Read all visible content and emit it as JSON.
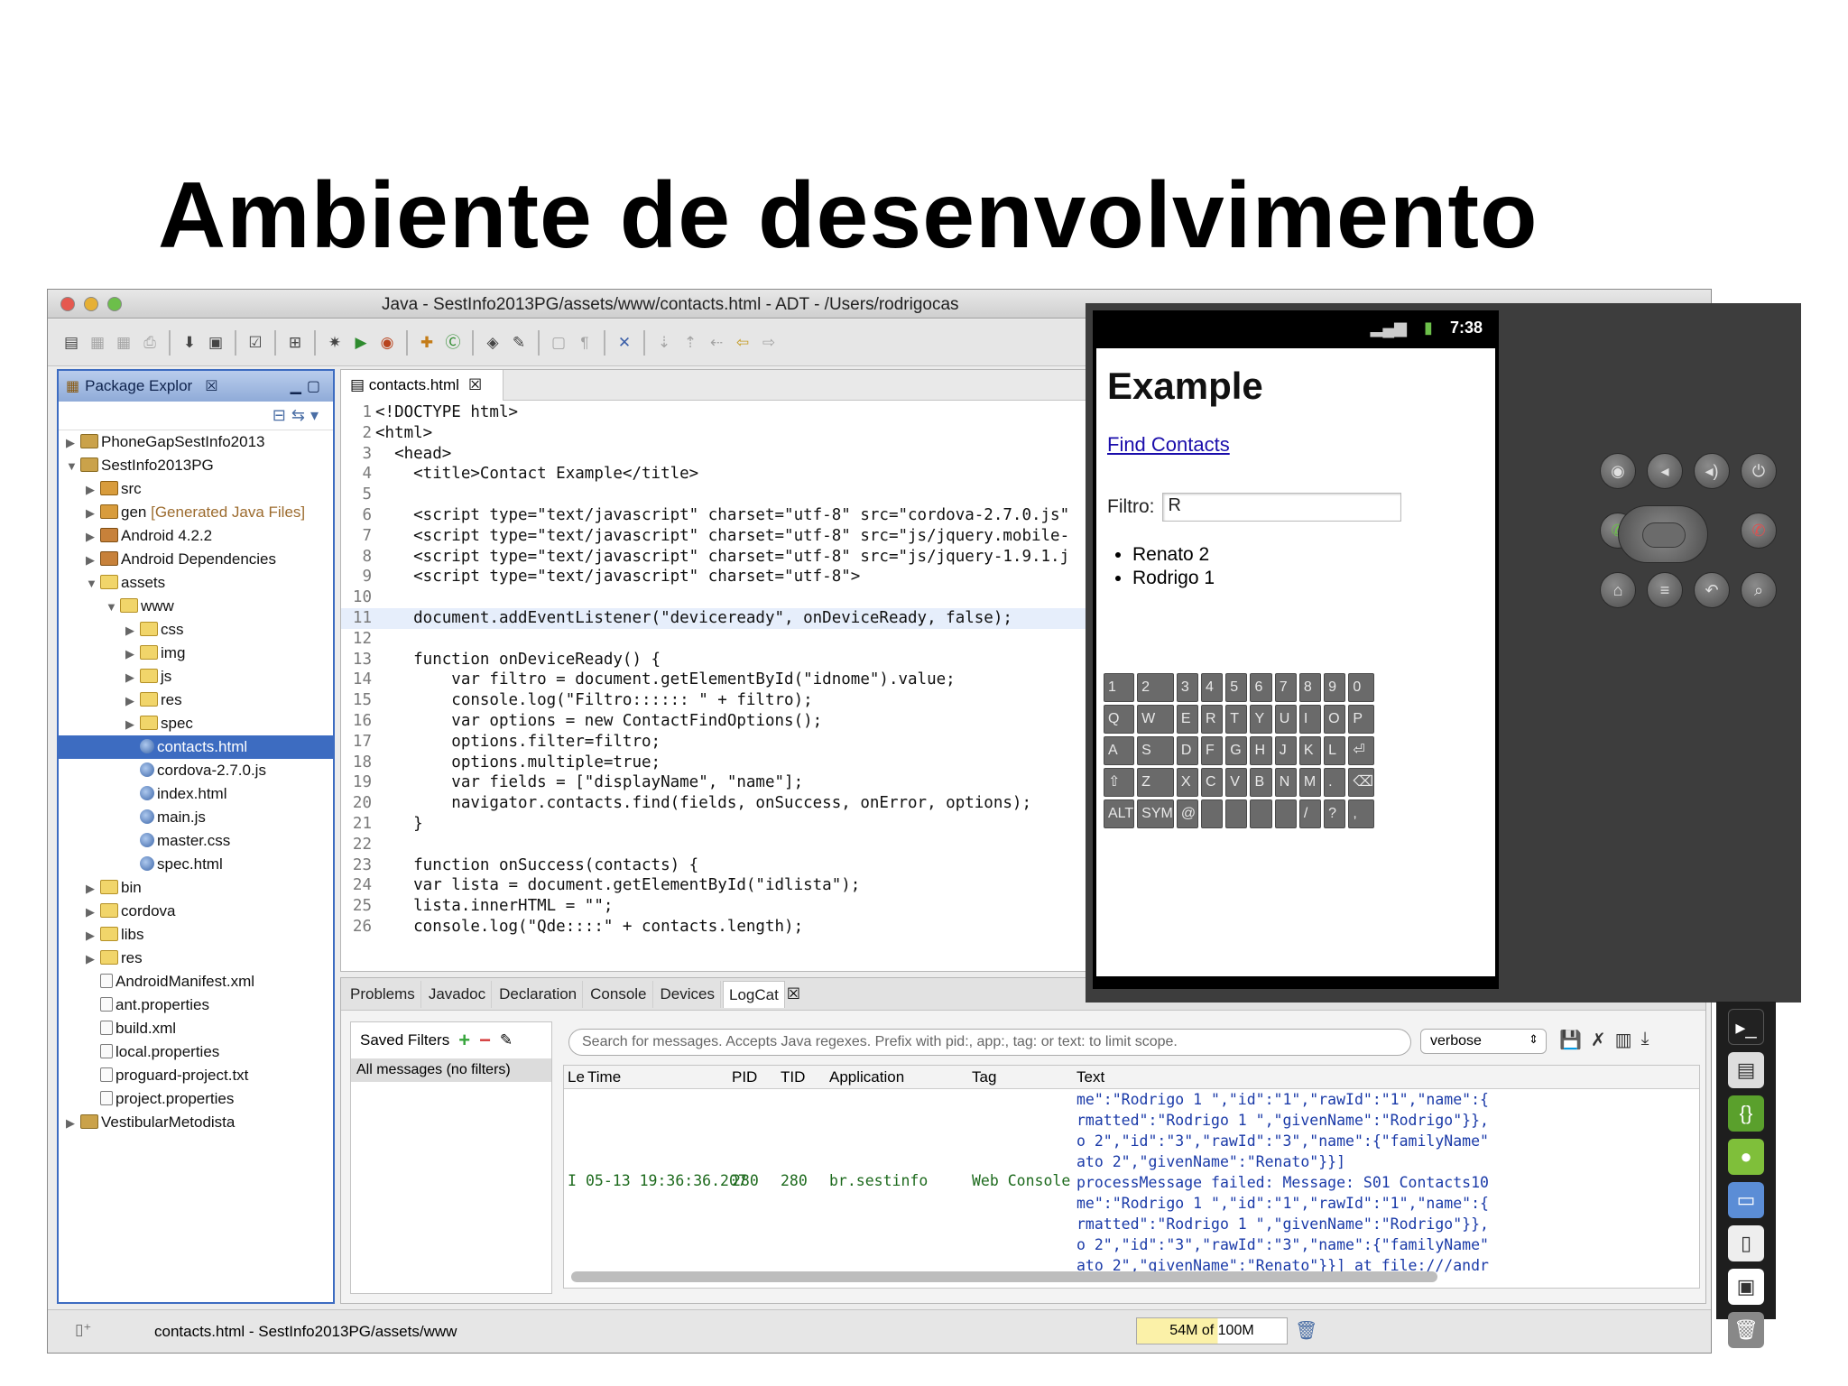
{
  "slide": {
    "title": "Ambiente de desenvolvimento"
  },
  "window": {
    "title": "Java - SestInfo2013PG/assets/www/contacts.html - ADT - /Users/rodrigocas"
  },
  "package_explorer": {
    "tab_label": "Package Explor",
    "items": [
      {
        "label": "PhoneGapSestInfo2013",
        "depth": 0,
        "arrow": "▶",
        "icon": "project-icon"
      },
      {
        "label": "SestInfo2013PG",
        "depth": 0,
        "arrow": "▼",
        "icon": "project-icon"
      },
      {
        "label": "src",
        "depth": 1,
        "arrow": "▶",
        "icon": "package-folder-icon"
      },
      {
        "label": "gen",
        "hint": "[Generated Java Files]",
        "depth": 1,
        "arrow": "▶",
        "icon": "package-folder-icon"
      },
      {
        "label": "Android 4.2.2",
        "depth": 1,
        "arrow": "▶",
        "icon": "library-icon"
      },
      {
        "label": "Android Dependencies",
        "depth": 1,
        "arrow": "▶",
        "icon": "library-icon"
      },
      {
        "label": "assets",
        "depth": 1,
        "arrow": "▼",
        "icon": "folder-icon"
      },
      {
        "label": "www",
        "depth": 2,
        "arrow": "▼",
        "icon": "folder-icon"
      },
      {
        "label": "css",
        "depth": 3,
        "arrow": "▶",
        "icon": "folder-icon"
      },
      {
        "label": "img",
        "depth": 3,
        "arrow": "▶",
        "icon": "folder-icon"
      },
      {
        "label": "js",
        "depth": 3,
        "arrow": "▶",
        "icon": "folder-icon"
      },
      {
        "label": "res",
        "depth": 3,
        "arrow": "▶",
        "icon": "folder-icon"
      },
      {
        "label": "spec",
        "depth": 3,
        "arrow": "▶",
        "icon": "folder-icon"
      },
      {
        "label": "contacts.html",
        "depth": 3,
        "arrow": "",
        "icon": "web-file-icon",
        "selected": true
      },
      {
        "label": "cordova-2.7.0.js",
        "depth": 3,
        "arrow": "",
        "icon": "web-file-icon"
      },
      {
        "label": "index.html",
        "depth": 3,
        "arrow": "",
        "icon": "web-file-icon"
      },
      {
        "label": "main.js",
        "depth": 3,
        "arrow": "",
        "icon": "web-file-icon"
      },
      {
        "label": "master.css",
        "depth": 3,
        "arrow": "",
        "icon": "web-file-icon"
      },
      {
        "label": "spec.html",
        "depth": 3,
        "arrow": "",
        "icon": "web-file-icon"
      },
      {
        "label": "bin",
        "depth": 1,
        "arrow": "▶",
        "icon": "folder-icon"
      },
      {
        "label": "cordova",
        "depth": 1,
        "arrow": "▶",
        "icon": "folder-icon"
      },
      {
        "label": "libs",
        "depth": 1,
        "arrow": "▶",
        "icon": "folder-icon"
      },
      {
        "label": "res",
        "depth": 1,
        "arrow": "▶",
        "icon": "folder-icon"
      },
      {
        "label": "AndroidManifest.xml",
        "depth": 1,
        "arrow": "",
        "icon": "file-icon"
      },
      {
        "label": "ant.properties",
        "depth": 1,
        "arrow": "",
        "icon": "file-icon"
      },
      {
        "label": "build.xml",
        "depth": 1,
        "arrow": "",
        "icon": "file-icon"
      },
      {
        "label": "local.properties",
        "depth": 1,
        "arrow": "",
        "icon": "file-icon"
      },
      {
        "label": "proguard-project.txt",
        "depth": 1,
        "arrow": "",
        "icon": "file-icon"
      },
      {
        "label": "project.properties",
        "depth": 1,
        "arrow": "",
        "icon": "file-icon"
      },
      {
        "label": "VestibularMetodista",
        "depth": 0,
        "arrow": "▶",
        "icon": "project-icon"
      }
    ]
  },
  "editor": {
    "tab_label": "contacts.html",
    "lines": [
      "<!DOCTYPE html>",
      "<html>",
      "  <head>",
      "    <title>Contact Example</title>",
      "",
      "    <script type=\"text/javascript\" charset=\"utf-8\" src=\"cordova-2.7.0.js\"",
      "    <script type=\"text/javascript\" charset=\"utf-8\" src=\"js/jquery.mobile-",
      "    <script type=\"text/javascript\" charset=\"utf-8\" src=\"js/jquery-1.9.1.j",
      "    <script type=\"text/javascript\" charset=\"utf-8\">",
      "",
      "    document.addEventListener(\"deviceready\", onDeviceReady, false);",
      "",
      "    function onDeviceReady() {",
      "        var filtro = document.getElementById(\"idnome\").value;",
      "        console.log(\"Filtro:::::: \" + filtro);",
      "        var options = new ContactFindOptions();",
      "        options.filter=filtro;",
      "        options.multiple=true;",
      "        var fields = [\"displayName\", \"name\"];",
      "        navigator.contacts.find(fields, onSuccess, onError, options);",
      "    }",
      "",
      "    function onSuccess(contacts) {",
      "    var lista = document.getElementById(\"idlista\");",
      "    lista.innerHTML = \"\";",
      "    console.log(\"Qde::::\" + contacts.length);"
    ],
    "highlighted_line": 11
  },
  "bottom_tabs": [
    "Problems",
    "Javadoc",
    "Declaration",
    "Console",
    "Devices",
    "LogCat"
  ],
  "logcat": {
    "saved_filters": "Saved Filters",
    "all_messages": "All messages (no filters)",
    "search_placeholder": "Search for messages. Accepts Java regexes. Prefix with pid:, app:, tag: or text: to limit scope.",
    "level": "verbose",
    "columns": [
      "Le",
      "Time",
      "PID",
      "TID",
      "Application",
      "Tag",
      "Text"
    ],
    "row": {
      "level": "I",
      "time": "05-13 19:36:36.207",
      "pid": "280",
      "tid": "280",
      "app": "br.sestinfo",
      "tag": "Web Console"
    },
    "text_lines": [
      "me\":\"Rodrigo 1 \",\"id\":\"1\",\"rawId\":\"1\",\"name\":{",
      "rmatted\":\"Rodrigo 1 \",\"givenName\":\"Rodrigo\"}},",
      "o 2\",\"id\":\"3\",\"rawId\":\"3\",\"name\":{\"familyName\"",
      "ato 2\",\"givenName\":\"Renato\"}}]",
      "processMessage failed: Message: S01 Contacts10",
      "me\":\"Rodrigo 1 \",\"id\":\"1\",\"rawId\":\"1\",\"name\":{",
      "rmatted\":\"Rodrigo 1 \",\"givenName\":\"Rodrigo\"}},",
      "o 2\",\"id\":\"3\",\"rawId\":\"3\",\"name\":{\"familyName\"",
      "ato 2\",\"givenName\":\"Renato\"}}] at file:///andr"
    ]
  },
  "statusbar": {
    "path": "contacts.html - SestInfo2013PG/assets/www",
    "memory": "54M of 100M",
    "memory_used_fraction": 0.54
  },
  "emulator": {
    "clock": "7:38",
    "signal": "3G",
    "app_title": "Example",
    "find_link": "Find Contacts",
    "filter_label": "Filtro:",
    "filter_value": "R",
    "results": [
      "Renato 2",
      "Rodrigo 1"
    ],
    "keys": [
      "1",
      "2",
      "3",
      "4",
      "5",
      "6",
      "7",
      "8",
      "9",
      "0",
      "Q",
      "W",
      "E",
      "R",
      "T",
      "Y",
      "U",
      "I",
      "O",
      "P",
      "A",
      "S",
      "D",
      "F",
      "G",
      "H",
      "J",
      "K",
      "L",
      "⏎",
      "⇧",
      "Z",
      "X",
      "C",
      "V",
      "B",
      "N",
      "M",
      ".",
      "⌫",
      "ALT",
      "SYM",
      "@",
      "",
      "",
      "",
      "",
      "/",
      "?",
      ","
    ]
  }
}
